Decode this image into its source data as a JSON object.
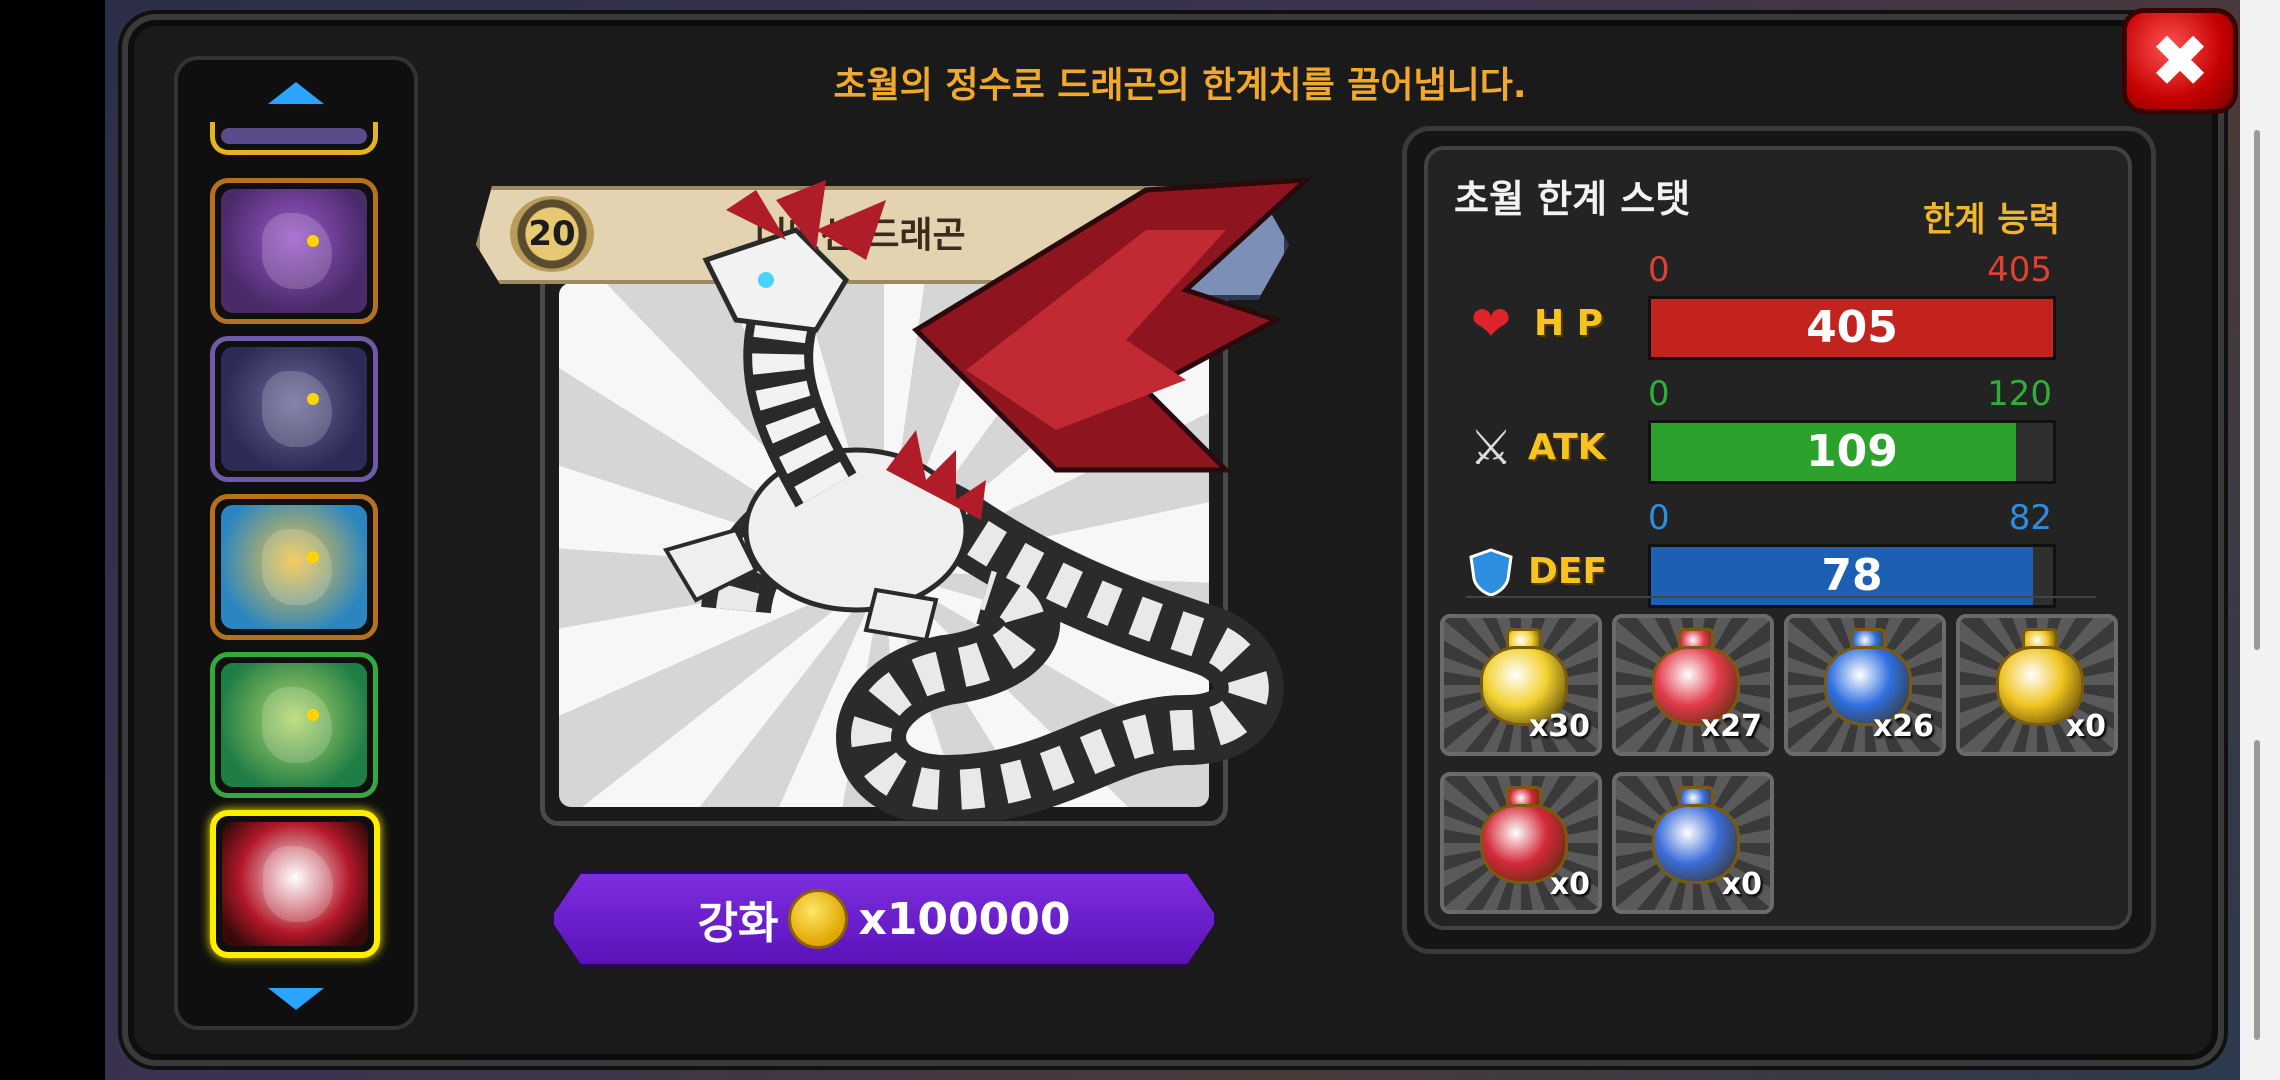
{
  "header": {
    "message": "초월의 정수로 드래곤의 한계치를 끌어냅니다."
  },
  "close_button": {
    "label": "✖",
    "icon": "close-icon"
  },
  "sidebar": {
    "up_icon": "arrow-up-icon",
    "down_icon": "arrow-down-icon",
    "items": [
      {
        "name": "purple-dragon",
        "selected": false
      },
      {
        "name": "shadow-dragon",
        "selected": false
      },
      {
        "name": "yellow-dragon",
        "selected": false
      },
      {
        "name": "green-dragon",
        "selected": false
      },
      {
        "name": "dimension-dragon",
        "selected": true
      }
    ]
  },
  "dragon": {
    "level": "20",
    "name": "디멘션 드래곤"
  },
  "upgrade": {
    "label": "강화",
    "cost": "x100000",
    "coin_icon": "gold-coin-icon"
  },
  "stats": {
    "title": "초월 한계 스탯",
    "subtitle": "한계 능력",
    "rows": [
      {
        "key": "hp",
        "label": "H P",
        "icon": "heart-icon",
        "min": "0",
        "max": "405",
        "value": "405",
        "fill": 1.0,
        "color": "#c2231f",
        "range_color": "#e0402f"
      },
      {
        "key": "atk",
        "label": "ATK",
        "icon": "crossed-swords-icon",
        "min": "0",
        "max": "120",
        "value": "109",
        "fill": 0.908,
        "color": "#2ca12c",
        "range_color": "#2fae38"
      },
      {
        "key": "def",
        "label": "DEF",
        "icon": "shield-icon",
        "min": "0",
        "max": "82",
        "value": "78",
        "fill": 0.951,
        "color": "#1d5fb2",
        "range_color": "#2d8ee0"
      }
    ]
  },
  "potions": [
    {
      "name": "small-yellow-potion",
      "count": "x30",
      "color": "#f2d230"
    },
    {
      "name": "small-red-potion",
      "count": "x27",
      "color": "#e23b4a"
    },
    {
      "name": "small-blue-potion",
      "count": "x26",
      "color": "#2f6fe0"
    },
    {
      "name": "large-yellow-potion",
      "count": "x0",
      "color": "#f0c420"
    },
    {
      "name": "large-red-potion",
      "count": "x0",
      "color": "#d42a3a"
    },
    {
      "name": "large-blue-potion",
      "count": "x0",
      "color": "#3a6cd8"
    }
  ]
}
